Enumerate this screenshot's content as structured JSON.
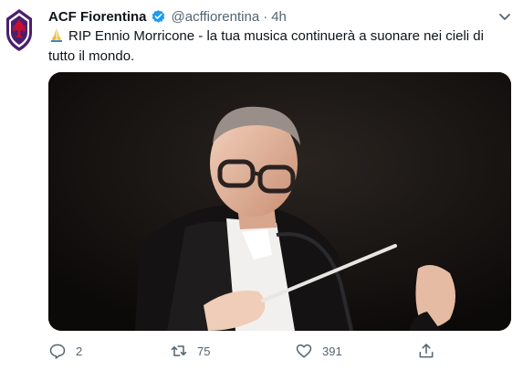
{
  "tweet": {
    "author_name": "ACF Fiorentina",
    "handle": "@acffiorentina",
    "separator": "·",
    "time": "4h",
    "text_line1": "RIP Ennio Morricone - la tua musica continuerà a suonare nei cieli di",
    "text_line2": "tutto il mondo."
  },
  "actions": {
    "reply_count": "2",
    "retweet_count": "75",
    "like_count": "391"
  },
  "icons": {
    "verified": "verified-badge-icon",
    "caret": "chevron-down-icon",
    "emoji": "folded-hands-emoji",
    "reply": "reply-icon",
    "retweet": "retweet-icon",
    "like": "heart-icon",
    "share": "share-icon"
  },
  "colors": {
    "verified_blue": "#1d9bf0",
    "muted_text": "#536471",
    "fiorentina_purple": "#4b1f6f",
    "fiorentina_red": "#c8102e"
  }
}
